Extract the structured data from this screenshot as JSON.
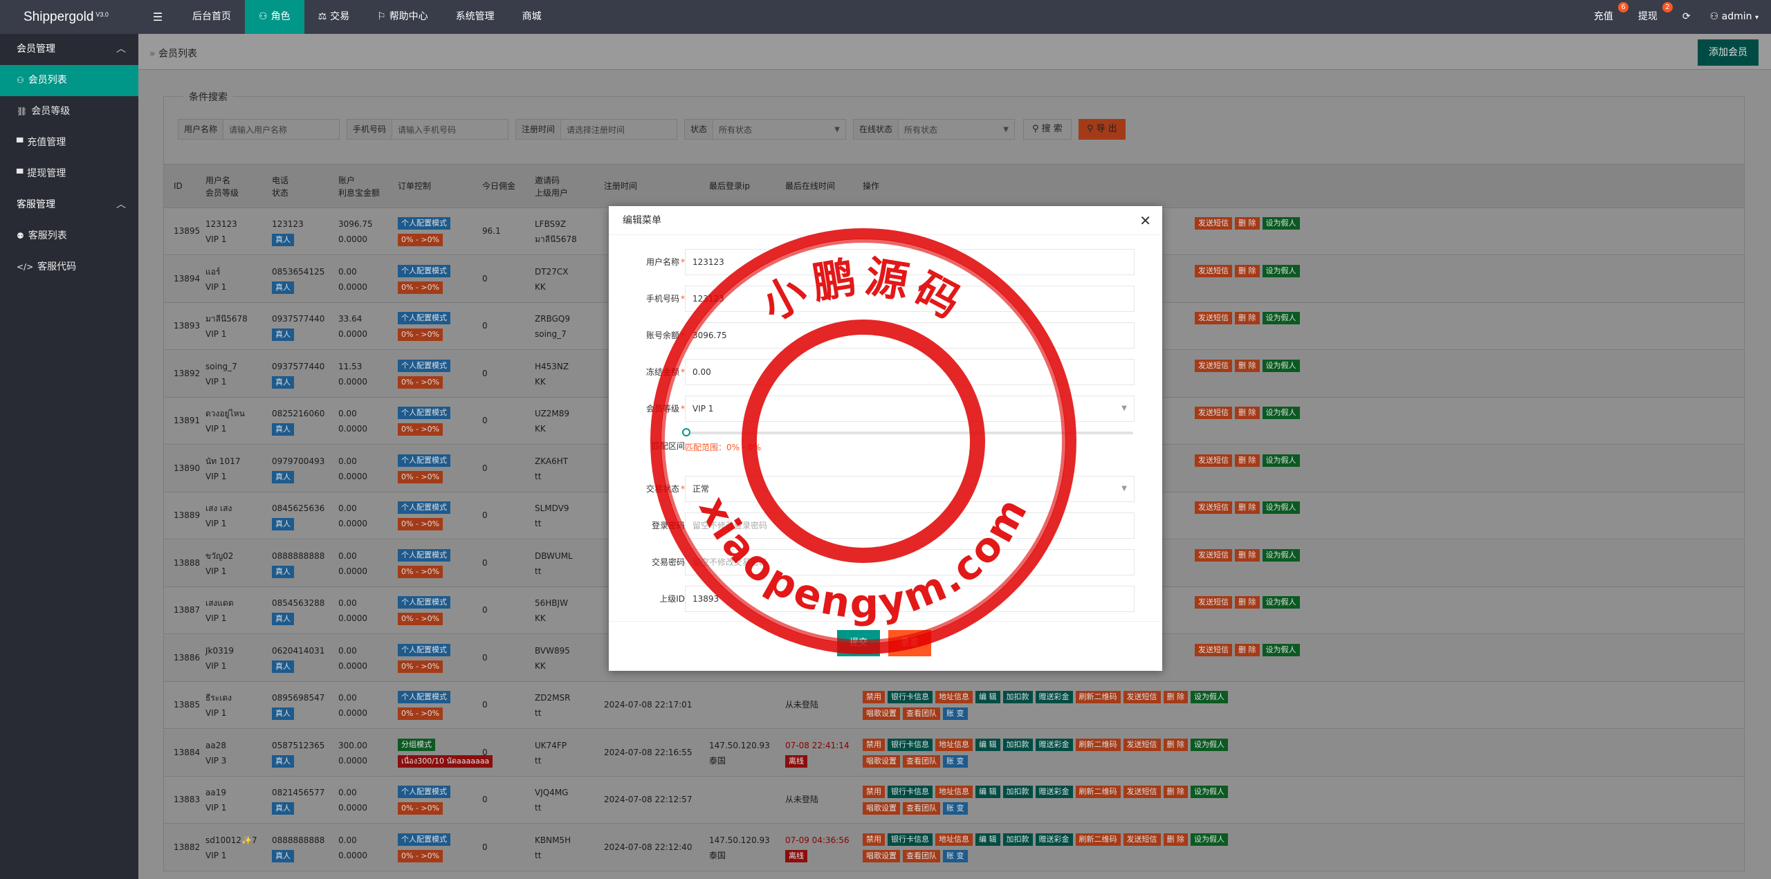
{
  "header": {
    "logo": "Shippergold",
    "version": "V3.0",
    "nav": [
      {
        "label": "后台首页",
        "icon": "",
        "active": false
      },
      {
        "label": "角色",
        "icon": "user-icon",
        "active": true
      },
      {
        "label": "交易",
        "icon": "scale-icon",
        "active": false
      },
      {
        "label": "帮助中心",
        "icon": "flag-icon",
        "active": false
      },
      {
        "label": "系统管理",
        "icon": "",
        "active": false
      },
      {
        "label": "商城",
        "icon": "",
        "active": false
      }
    ],
    "recharge_label": "充值",
    "recharge_badge": "6",
    "withdraw_label": "提现",
    "withdraw_badge": "2",
    "user": "admin"
  },
  "sidebar": {
    "groups": [
      {
        "label": "会员管理",
        "items": [
          {
            "label": "会员列表",
            "icon": "user-icon",
            "active": true
          },
          {
            "label": "会员等级",
            "icon": "link-icon",
            "active": false
          },
          {
            "label": "充值管理",
            "icon": "chat-icon",
            "active": false
          },
          {
            "label": "提现管理",
            "icon": "chat-icon",
            "active": false
          }
        ]
      },
      {
        "label": "客服管理",
        "items": [
          {
            "label": "客服列表",
            "icon": "users-icon",
            "active": false
          },
          {
            "label": "客服代码",
            "icon": "code-icon",
            "active": false
          }
        ]
      }
    ]
  },
  "breadcrumb": "会员列表",
  "add_member": "添加会员",
  "filter": {
    "legend": "条件搜索",
    "username_label": "用户名称",
    "username_ph": "请输入用户名称",
    "phone_label": "手机号码",
    "phone_ph": "请输入手机号码",
    "regtime_label": "注册时间",
    "regtime_ph": "请选择注册时间",
    "status_label": "状态",
    "status_value": "所有状态",
    "online_label": "在线状态",
    "online_value": "所有状态",
    "search_btn": "搜 索",
    "export_btn": "导 出"
  },
  "table": {
    "headers": {
      "id": "ID",
      "user1": "用户名",
      "user2": "会员等级",
      "phone1": "电话",
      "phone2": "状态",
      "acct1": "账户",
      "acct2": "利息宝金额",
      "order": "订单控制",
      "comm": "今日佣金",
      "inv1": "邀请码",
      "inv2": "上级用户",
      "reg": "注册时间",
      "lastip": "最后登录ip",
      "lastonline": "最后在线时间",
      "ops": "操作"
    },
    "rows": [
      {
        "id": "13895",
        "user": "123123",
        "vip": "VIP 1",
        "phone": "123123",
        "status": "真人",
        "bal": "3096.75",
        "interest": "0.0000",
        "mode": "个人配置模式",
        "range": "0% - >0%",
        "comm": "96.1",
        "code": "LFBS9Z",
        "parent": "มาลีนี5678",
        "reg": "",
        "ip": "",
        "ip2": "",
        "online": "",
        "online_tag": ""
      },
      {
        "id": "13894",
        "user": "แอร์",
        "vip": "VIP 1",
        "phone": "0853654125",
        "status": "真人",
        "bal": "0.00",
        "interest": "0.0000",
        "mode": "个人配置模式",
        "range": "0% - >0%",
        "comm": "0",
        "code": "DT27CX",
        "parent": "KK",
        "reg": "",
        "ip": "",
        "ip2": "",
        "online": "",
        "online_tag": ""
      },
      {
        "id": "13893",
        "user": "มาลีนี5678",
        "vip": "VIP 1",
        "phone": "0937577440",
        "status": "真人",
        "bal": "33.64",
        "interest": "0.0000",
        "mode": "个人配置模式",
        "range": "0% - >0%",
        "comm": "0",
        "code": "ZRBGQ9",
        "parent": "soing_7",
        "reg": "",
        "ip": "",
        "ip2": "",
        "online": "",
        "online_tag": ""
      },
      {
        "id": "13892",
        "user": "soing_7",
        "vip": "VIP 1",
        "phone": "0937577440",
        "status": "真人",
        "bal": "11.53",
        "interest": "0.0000",
        "mode": "个人配置模式",
        "range": "0% - >0%",
        "comm": "0",
        "code": "H453NZ",
        "parent": "KK",
        "reg": "",
        "ip": "",
        "ip2": "",
        "online": "",
        "online_tag": ""
      },
      {
        "id": "13891",
        "user": "ดวงอยู่ไหน",
        "vip": "VIP 1",
        "phone": "0825216060",
        "status": "真人",
        "bal": "0.00",
        "interest": "0.0000",
        "mode": "个人配置模式",
        "range": "0% - >0%",
        "comm": "0",
        "code": "UZ2M89",
        "parent": "KK",
        "reg": "",
        "ip": "",
        "ip2": "",
        "online": "",
        "online_tag": ""
      },
      {
        "id": "13890",
        "user": "นัท 1017",
        "vip": "VIP 1",
        "phone": "0979700493",
        "status": "真人",
        "bal": "0.00",
        "interest": "0.0000",
        "mode": "个人配置模式",
        "range": "0% - >0%",
        "comm": "0",
        "code": "ZKA6HT",
        "parent": "tt",
        "reg": "",
        "ip": "",
        "ip2": "",
        "online": "",
        "online_tag": ""
      },
      {
        "id": "13889",
        "user": "เสง เสง",
        "vip": "VIP 1",
        "phone": "0845625636",
        "status": "真人",
        "bal": "0.00",
        "interest": "0.0000",
        "mode": "个人配置模式",
        "range": "0% - >0%",
        "comm": "0",
        "code": "SLMDV9",
        "parent": "tt",
        "reg": "",
        "ip": "",
        "ip2": "",
        "online": "",
        "online_tag": ""
      },
      {
        "id": "13888",
        "user": "ขวัญ02",
        "vip": "VIP 1",
        "phone": "0888888888",
        "status": "真人",
        "bal": "0.00",
        "interest": "0.0000",
        "mode": "个人配置模式",
        "range": "0% - >0%",
        "comm": "0",
        "code": "DBWUML",
        "parent": "tt",
        "reg": "",
        "ip": "",
        "ip2": "",
        "online": "",
        "online_tag": ""
      },
      {
        "id": "13887",
        "user": "เสงแดด",
        "vip": "VIP 1",
        "phone": "0854563288",
        "status": "真人",
        "bal": "0.00",
        "interest": "0.0000",
        "mode": "个人配置模式",
        "range": "0% - >0%",
        "comm": "0",
        "code": "56HBJW",
        "parent": "KK",
        "reg": "",
        "ip": "",
        "ip2": "",
        "online": "",
        "online_tag": ""
      },
      {
        "id": "13886",
        "user": "Jk0319",
        "vip": "VIP 1",
        "phone": "0620414031",
        "status": "真人",
        "bal": "0.00",
        "interest": "0.0000",
        "mode": "个人配置模式",
        "range": "0% - >0%",
        "comm": "0",
        "code": "BVW895",
        "parent": "KK",
        "reg": "",
        "ip": "",
        "ip2": "",
        "online": "",
        "online_tag": ""
      },
      {
        "id": "13885",
        "user": "ธีระเดง",
        "vip": "VIP 1",
        "phone": "0895698547",
        "status": "真人",
        "bal": "0.00",
        "interest": "0.0000",
        "mode": "个人配置模式",
        "range": "0% - >0%",
        "comm": "0",
        "code": "ZD2MSR",
        "parent": "tt",
        "reg": "2024-07-08 22:17:01",
        "ip": "",
        "ip2": "",
        "online": "从未登陆",
        "online_tag": ""
      },
      {
        "id": "13884",
        "user": "aa28",
        "vip": "VIP 3",
        "phone": "0587512365",
        "status": "真人",
        "bal": "300.00",
        "interest": "0.0000",
        "mode": "分组模式",
        "range": "เนื่อง300/10 นัดaaaaaaa",
        "comm": "0",
        "code": "UK74FP",
        "parent": "tt",
        "reg": "2024-07-08 22:16:55",
        "ip": "147.50.120.93",
        "ip2": "泰国",
        "online": "07-08 22:41:14",
        "online_tag": "离线"
      },
      {
        "id": "13883",
        "user": "aa19",
        "vip": "VIP 1",
        "phone": "0821456577",
        "status": "真人",
        "bal": "0.00",
        "interest": "0.0000",
        "mode": "个人配置模式",
        "range": "0% - >0%",
        "comm": "0",
        "code": "VJQ4MG",
        "parent": "tt",
        "reg": "2024-07-08 22:12:57",
        "ip": "",
        "ip2": "",
        "online": "从未登陆",
        "online_tag": ""
      },
      {
        "id": "13882",
        "user": "sd10012✨7",
        "vip": "VIP 1",
        "phone": "0888888888",
        "status": "真人",
        "bal": "0.00",
        "interest": "0.0000",
        "mode": "个人配置模式",
        "range": "0% - >0%",
        "comm": "0",
        "code": "KBNM5H",
        "parent": "tt",
        "reg": "2024-07-08 22:12:40",
        "ip": "147.50.120.93",
        "ip2": "泰国",
        "online": "07-09 04:36:56",
        "online_tag": "离线"
      }
    ],
    "ops_row1": [
      "禁用",
      "银行卡信息",
      "地址信息",
      "编 辑",
      "加扣款",
      "赠送彩金",
      "刷新二维码",
      "发送短信",
      "删 除",
      "设为假人"
    ],
    "ops_row2": [
      "唱歌设置",
      "查看团队",
      "账 变"
    ],
    "ops_short": [
      "发送短信",
      "删 除",
      "设为假人"
    ]
  },
  "modal": {
    "title": "编辑菜单",
    "fields": {
      "username_label": "用户名称",
      "username": "123123",
      "phone_label": "手机号码",
      "phone": "123123",
      "balance_label": "账号余额",
      "balance": "3096.75",
      "frozen_label": "冻结金额",
      "frozen": "0.00",
      "level_label": "会员等级",
      "level": "VIP 1",
      "range_label": "匹配区间",
      "range_text": "匹配范围：0% - 0%",
      "trade_label": "交易状态",
      "trade": "正常",
      "loginpw_label": "登录密码",
      "loginpw_ph": "留空不修改登录密码",
      "tradepw_label": "交易密码",
      "tradepw_ph": "留空不修改交易密码",
      "parent_label": "上级ID",
      "parent": "13893"
    },
    "submit": "提交",
    "reset": "重置"
  },
  "watermark": {
    "top_text": "小鹏源码",
    "bottom_text": "xiaopengym.com",
    "color": "#e00000"
  }
}
